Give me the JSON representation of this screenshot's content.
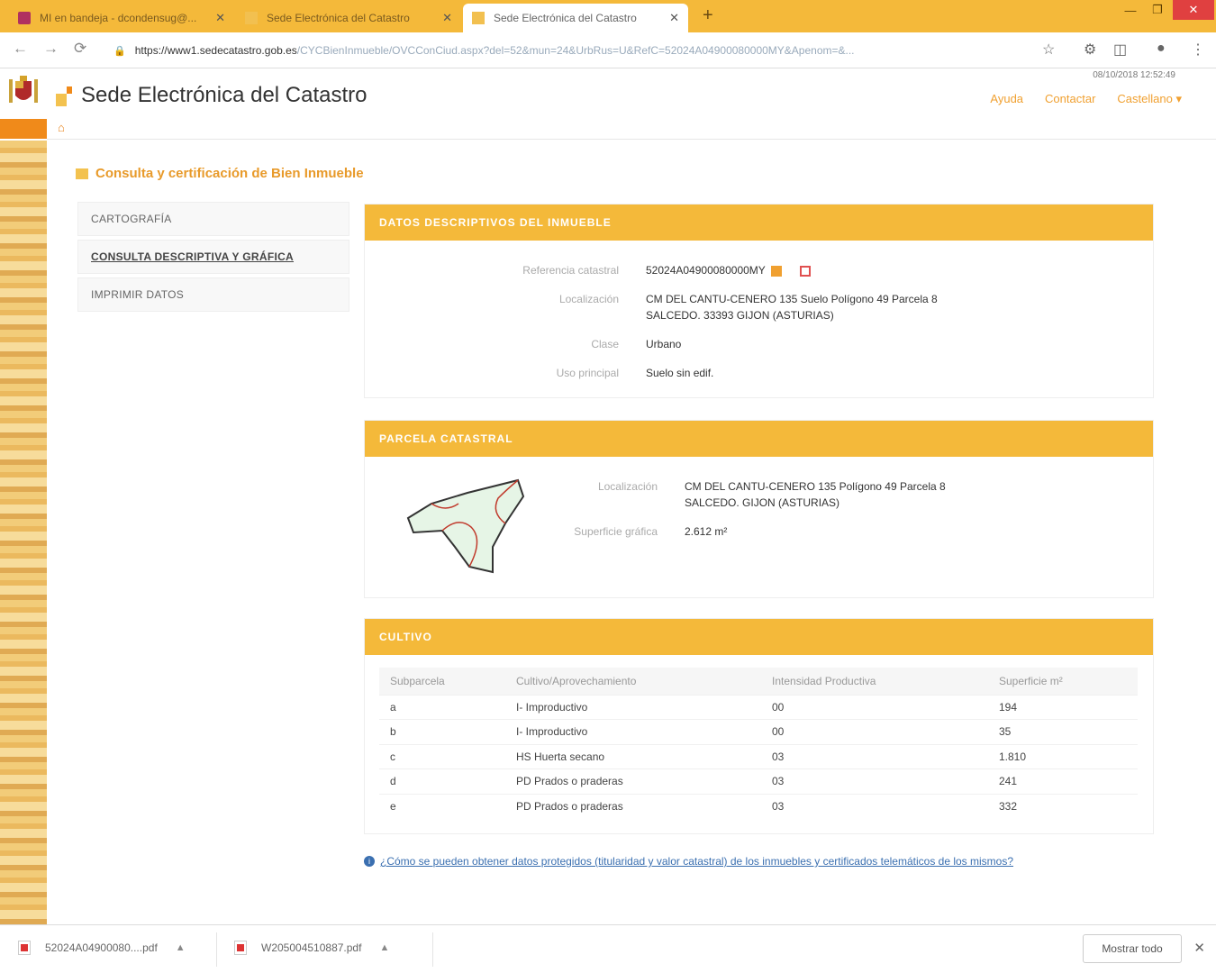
{
  "browser": {
    "tabs": [
      {
        "title": "MI en bandeja - dcondensug@..."
      },
      {
        "title": "Sede Electrónica del Catastro"
      },
      {
        "title": "Sede Electrónica del Catastro"
      }
    ],
    "url_host": "https://www1.sedecatastro.gob.es",
    "url_rest": "/CYCBienInmueble/OVCConCiud.aspx?del=52&mun=24&UrbRus=U&RefC=52024A04900080000MY&Apenom=&..."
  },
  "header": {
    "datetime": "08/10/2018 12:52:49",
    "site_title": "Sede Electrónica del Catastro",
    "links": [
      "Ayuda",
      "Contactar",
      "Castellano ▾"
    ]
  },
  "page": {
    "section_title": "Consulta y certificación de Bien Inmueble",
    "menu": [
      "CARTOGRAFÍA",
      "CONSULTA DESCRIPTIVA Y GRÁFICA",
      "IMPRIMIR DATOS"
    ]
  },
  "datos": {
    "header": "DATOS DESCRIPTIVOS DEL INMUEBLE",
    "ref_label": "Referencia catastral",
    "ref_value": "52024A04900080000MY",
    "loc_label": "Localización",
    "loc_line1": "CM DEL CANTU-CENERO 135 Suelo Polígono 49 Parcela 8",
    "loc_line2": "SALCEDO. 33393 GIJON (ASTURIAS)",
    "clase_label": "Clase",
    "clase_value": "Urbano",
    "uso_label": "Uso principal",
    "uso_value": "Suelo sin edif."
  },
  "parcela": {
    "header": "PARCELA CATASTRAL",
    "loc_label": "Localización",
    "loc_line1": "CM DEL CANTU-CENERO 135 Polígono 49 Parcela 8",
    "loc_line2": "SALCEDO. GIJON (ASTURIAS)",
    "sup_label": "Superficie gráfica",
    "sup_value": "2.612 m²"
  },
  "cultivo": {
    "header": "CULTIVO",
    "columns": [
      "Subparcela",
      "Cultivo/Aprovechamiento",
      "Intensidad Productiva",
      "Superficie m²"
    ],
    "rows": [
      [
        "a",
        "I- Improductivo",
        "00",
        "194"
      ],
      [
        "b",
        "I- Improductivo",
        "00",
        "35"
      ],
      [
        "c",
        "HS Huerta secano",
        "03",
        "1.810"
      ],
      [
        "d",
        "PD Prados o praderas",
        "03",
        "241"
      ],
      [
        "e",
        "PD Prados o praderas",
        "03",
        "332"
      ]
    ]
  },
  "help_link": "¿Cómo se pueden obtener datos protegidos (titularidad y valor catastral) de los inmuebles y certificados telemáticos de los mismos?",
  "downloads": {
    "files": [
      "52024A04900080....pdf",
      "W205004510887.pdf"
    ],
    "show_all": "Mostrar todo"
  },
  "colors": {
    "accent": "#f4b93a",
    "title_orange": "#e89a2a",
    "link_blue": "#3a6fb0"
  }
}
